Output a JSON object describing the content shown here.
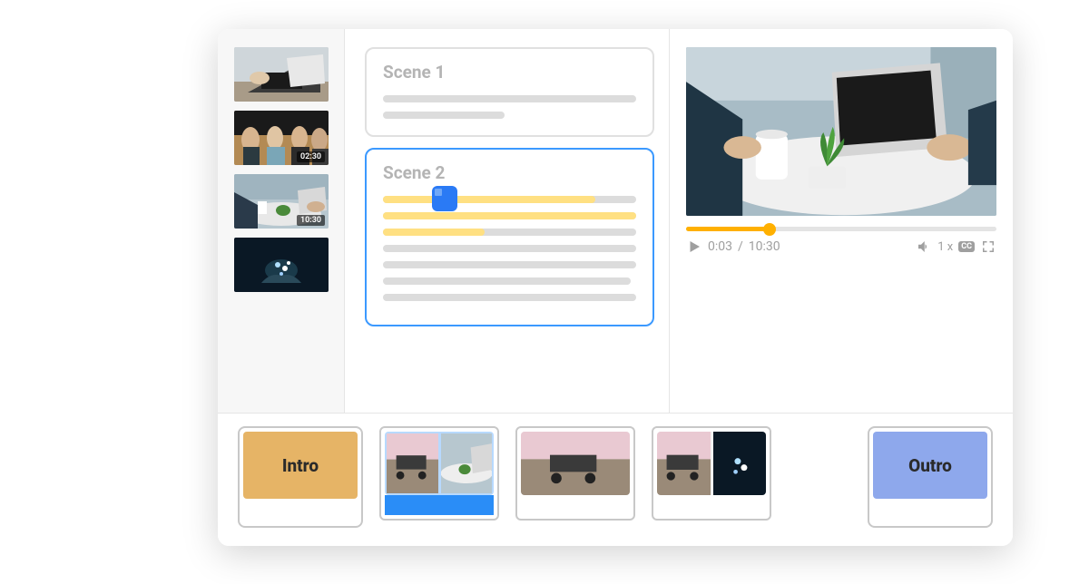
{
  "sidebar": {
    "clips": [
      {
        "duration": ""
      },
      {
        "duration": "02:30"
      },
      {
        "duration": "10:30"
      },
      {
        "duration": ""
      }
    ]
  },
  "scenes": {
    "first": {
      "title": "Scene 1"
    },
    "second": {
      "title": "Scene 2"
    }
  },
  "player": {
    "current_time": "0:03",
    "total_time": "10:30",
    "time_sep": " / ",
    "speed": "1 x",
    "cc_label": "CC",
    "progress_percent": 27
  },
  "strip": {
    "intro_label": "Intro",
    "outro_label": "Outro"
  }
}
